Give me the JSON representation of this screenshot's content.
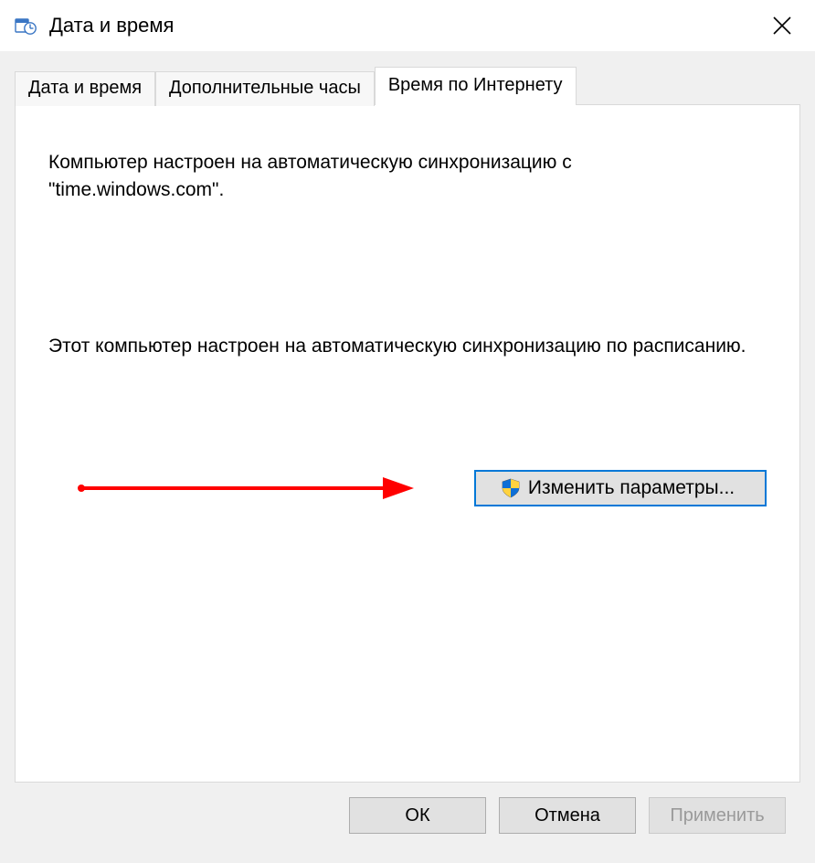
{
  "window": {
    "title": "Дата и время"
  },
  "tabs": [
    {
      "label": "Дата и время",
      "active": false
    },
    {
      "label": "Дополнительные часы",
      "active": false
    },
    {
      "label": "Время по Интернету",
      "active": true
    }
  ],
  "panel": {
    "sync_status": "Компьютер настроен на автоматическую синхронизацию с \"time.windows.com\".",
    "schedule_status": "Этот компьютер настроен на автоматическую синхронизацию по расписанию.",
    "change_button": "Изменить параметры..."
  },
  "buttons": {
    "ok": "ОК",
    "cancel": "Отмена",
    "apply": "Применить"
  },
  "annotation": {
    "arrow_color": "#ff0000"
  }
}
